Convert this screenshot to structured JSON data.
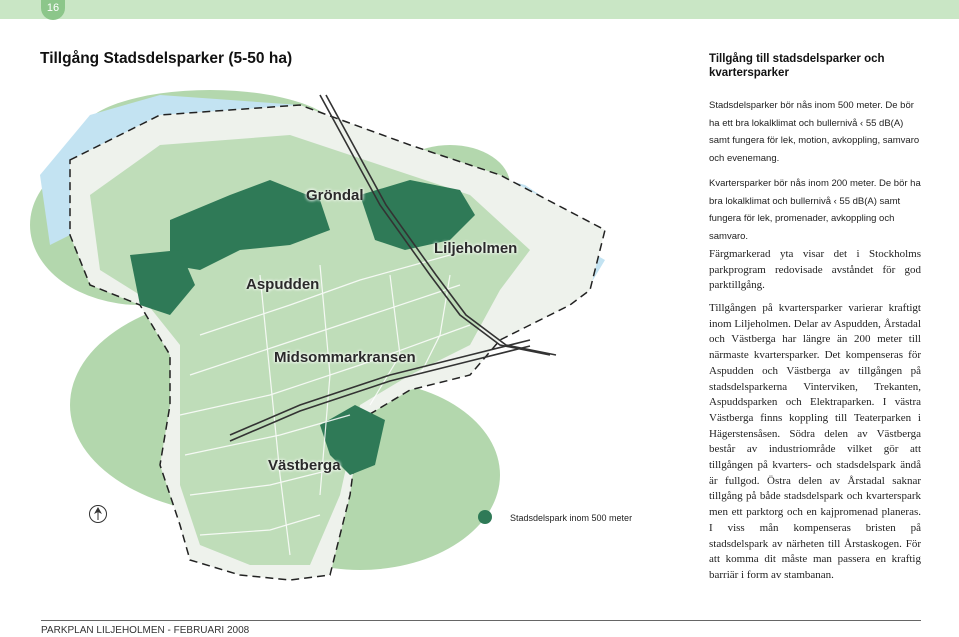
{
  "page_number": "16",
  "title": "Tillgång Stadsdelsparker (5-50 ha)",
  "map": {
    "labels": {
      "grondal": "Gröndal",
      "liljeholmen": "Liljeholmen",
      "aspudden": "Aspudden",
      "midsommarkransen": "Midsommarkransen",
      "vastberga": "Västberga"
    },
    "legend_text": "Stadsdelspark inom 500 meter",
    "colors": {
      "water": "#c3e3f2",
      "park_zone": "#b3d7ad",
      "park": "#2f7a57",
      "land": "#eef2ec"
    }
  },
  "sidebar": {
    "heading": "Tillgång till stadsdelsparker och kvartersparker",
    "p1": "Stadsdelsparker bör nås inom 500 meter. De bör ha ett bra lokalklimat och bullernivå ‹ 55 dB(A) samt fungera för lek, motion, avkoppling, samvaro och evenemang.",
    "p2": "Kvartersparker bör nås inom 200 meter. De bör ha bra lokalklimat och bullernivå ‹ 55 dB(A) samt fungera för lek, promenader, avkoppling och samvaro.",
    "p3": "Färgmarkerad yta visar det i Stockholms parkprogram redovisade avståndet för god parktillgång.",
    "p4": "Tillgången på kvartersparker varierar kraftigt inom Liljeholmen. Delar av Aspudden, Årstadal och Västberga har längre än 200 meter till närmaste kvartersparker. Det kompenseras för Aspudden och Västberga av tillgången på stadsdelsparkerna Vinterviken, Trekanten, Aspuddsparken och Elektraparken. I västra Västberga finns koppling till Teaterparken i Hägerstensåsen. Södra delen av Västberga består av industriområde vilket gör att tillgången på kvarters- och stadsdelspark ändå är fullgod. Östra delen av Årstadal saknar tillgång på både stadsdelspark och kvarterspark men ett parktorg och en kajpromenad planeras. I viss mån kompenseras bristen på stadsdelspark av närheten till Årstaskogen. För att komma dit måste man passera en kraftig barriär i form av stambanan."
  },
  "footer": "PARKPLAN LILJEHOLMEN - FEBRUARI 2008"
}
